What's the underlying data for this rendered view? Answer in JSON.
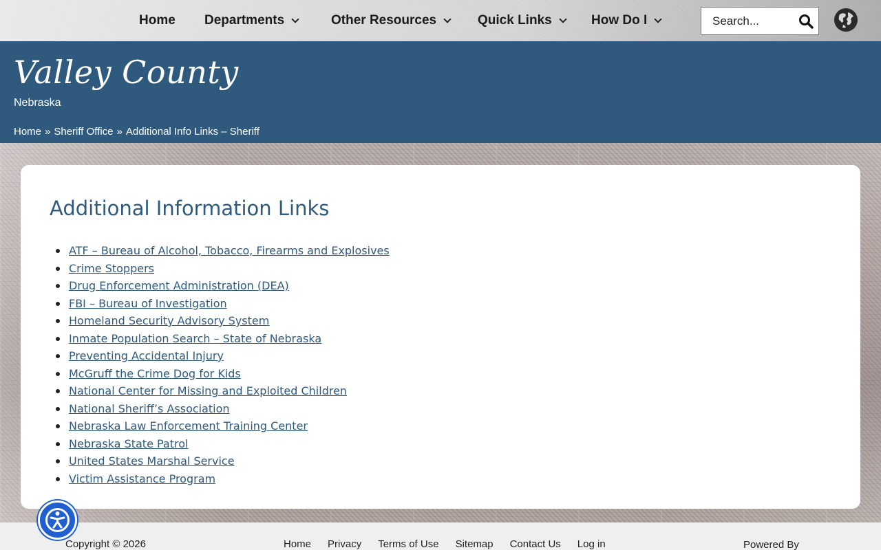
{
  "nav": {
    "items": [
      {
        "label": "Home",
        "has_menu": false
      },
      {
        "label": "Departments",
        "has_menu": true
      },
      {
        "label": "Other Resources",
        "has_menu": true
      },
      {
        "label": "Quick Links",
        "has_menu": true
      },
      {
        "label": "How Do I",
        "has_menu": true
      }
    ],
    "search_placeholder": "Search...",
    "search_icon": "search-icon",
    "language_icon": "globe-icon"
  },
  "header": {
    "title": "Valley County",
    "subtitle": "Nebraska",
    "breadcrumb": [
      "Home",
      "Sheriff Office",
      "Additional Info Links – Sheriff"
    ],
    "breadcrumb_separator": "»",
    "color": "#2f5a7e"
  },
  "main": {
    "heading": "Additional Information Links",
    "links": [
      "ATF – Bureau of Alcohol, Tobacco, Firearms and Explosives",
      "Crime Stoppers",
      "Drug Enforcement Administration (DEA)",
      "FBI – Bureau of Investigation",
      "Homeland Security Advisory System",
      "Inmate Population Search – State of Nebraska",
      "Preventing Accidental Injury",
      "McGruff the Crime Dog for Kids",
      "National Center for Missing and Exploited Children",
      "National Sheriff’s Association",
      "Nebraska Law Enforcement Training Center",
      "Nebraska State Patrol",
      "United States Marshal Service",
      "Victim Assistance Program"
    ]
  },
  "footer": {
    "copyright": "Copyright © 2026",
    "links": [
      "Home",
      "Privacy",
      "Terms of Use",
      "Sitemap",
      "Contact Us",
      "Log in"
    ],
    "powered": "Powered By"
  },
  "accessibility_icon": "accessibility-icon"
}
